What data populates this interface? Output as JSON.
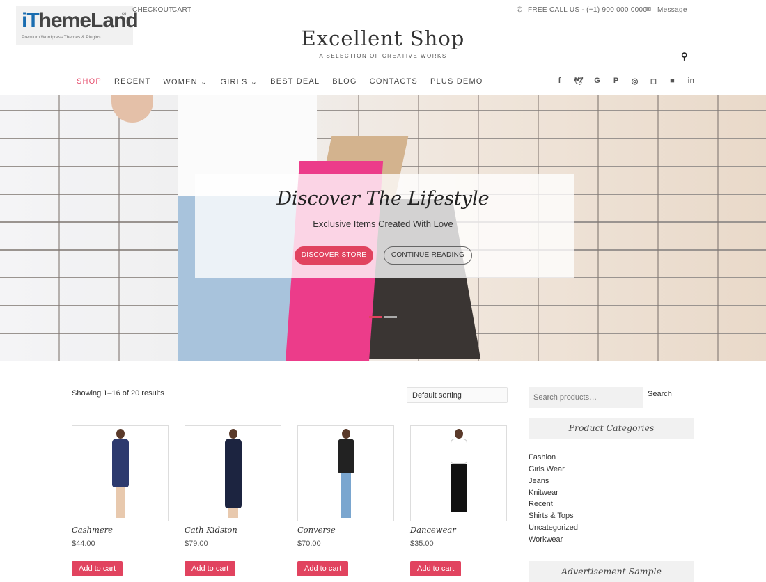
{
  "logo": {
    "brand_i": "iT",
    "brand_rest": "hemeLand",
    "co": "co",
    "tagline": "Premium Wordpress Themes & Plugins"
  },
  "topbar": {
    "links": [
      "CHECKOUT",
      "CART"
    ],
    "phone_icon": "phone-icon",
    "phone_text": "FREE CALL US - (+1) 900 000 0000",
    "mail_icon": "envelope-icon",
    "message_label": "Message"
  },
  "site": {
    "title": "Excellent Shop",
    "tagline": "A SELECTION OF CREATIVE WORKS",
    "search_icon": "search-icon"
  },
  "nav": {
    "items": [
      {
        "label": "SHOP",
        "active": true
      },
      {
        "label": "RECENT"
      },
      {
        "label": "WOMEN ⌄"
      },
      {
        "label": "GIRLS ⌄"
      },
      {
        "label": "BEST DEAL"
      },
      {
        "label": "BLOG"
      },
      {
        "label": "CONTACTS"
      },
      {
        "label": "PLUS DEMO"
      }
    ]
  },
  "social": [
    {
      "name": "facebook",
      "glyph": "f"
    },
    {
      "name": "twitter",
      "glyph": "🐦"
    },
    {
      "name": "google-plus",
      "glyph": "G"
    },
    {
      "name": "pinterest",
      "glyph": "P"
    },
    {
      "name": "dribbble",
      "glyph": "◎"
    },
    {
      "name": "instagram",
      "glyph": "◙"
    },
    {
      "name": "flickr",
      "glyph": "●●"
    },
    {
      "name": "linkedin",
      "glyph": "in"
    }
  ],
  "hero": {
    "title": "Discover The Lifestyle",
    "subtitle": "Exclusive Items Created With Love",
    "primary_button": "DISCOVER STORE",
    "secondary_button": "CONTINUE READING",
    "slides_total": 2,
    "active_slide": 1
  },
  "shop": {
    "results_text": "Showing 1–16 of 20 results",
    "sort_selected": "Default sorting",
    "products": [
      {
        "name": "Cashmere",
        "price": "$44.00",
        "button": "Add to cart",
        "color": "#2d3a6e"
      },
      {
        "name": "Cath Kidston",
        "price": "$79.00",
        "button": "Add to cart",
        "color": "#1c2440"
      },
      {
        "name": "Converse",
        "price": "$70.00",
        "button": "Add to cart",
        "color": "#222222"
      },
      {
        "name": "Dancewear",
        "price": "$35.00",
        "button": "Add to cart",
        "color": "#111111"
      }
    ]
  },
  "sidebar": {
    "search_placeholder": "Search products…",
    "search_button": "Search",
    "categories_title": "Product Categories",
    "categories": [
      "Fashion",
      "Girls Wear",
      "Jeans",
      "Knitwear",
      "Recent",
      "Shirts & Tops",
      "Uncategorized",
      "Workwear"
    ],
    "ad_title": "Advertisement Sample"
  },
  "colors": {
    "accent": "#e1435f",
    "nav_active": "#e6506e",
    "widget_bg": "#f1f1f1"
  }
}
